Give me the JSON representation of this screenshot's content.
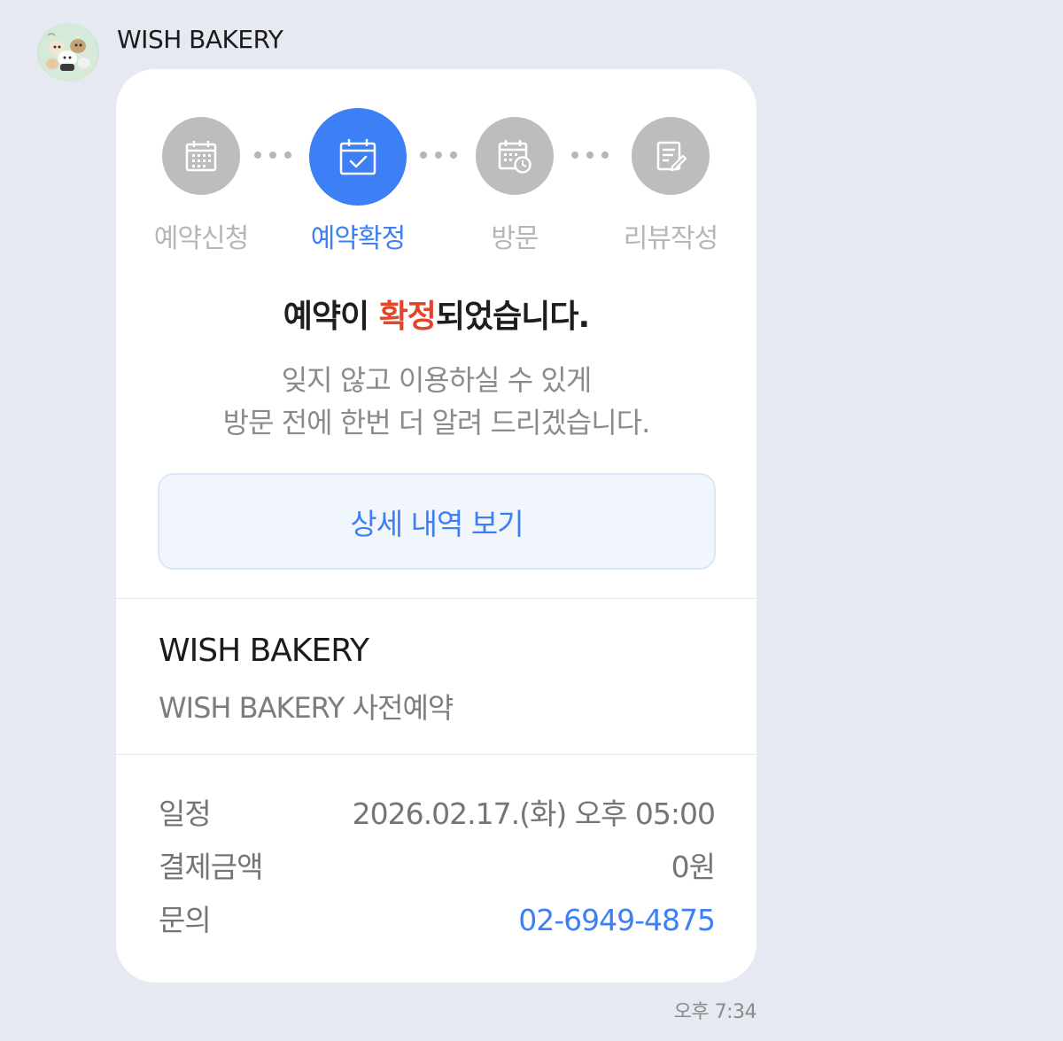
{
  "chat": {
    "sender_name": "WISH BAKERY",
    "timestamp": "오후 7:34"
  },
  "steps": [
    {
      "label": "예약신청",
      "icon": "calendar-icon",
      "active": false
    },
    {
      "label": "예약확정",
      "icon": "calendar-check-icon",
      "active": true
    },
    {
      "label": "방문",
      "icon": "calendar-clock-icon",
      "active": false
    },
    {
      "label": "리뷰작성",
      "icon": "review-edit-icon",
      "active": false
    }
  ],
  "message": {
    "headline_before": "예약이 ",
    "headline_highlight": "확정",
    "headline_after": "되었습니다.",
    "sub_line1": "잊지 않고 이용하실 수 있게",
    "sub_line2": "방문 전에 한번 더 알려 드리겠습니다.",
    "detail_button": "상세 내역 보기"
  },
  "store": {
    "name": "WISH BAKERY",
    "subtitle": "WISH BAKERY 사전예약"
  },
  "info": {
    "schedule_label": "일정",
    "schedule_value": "2026.02.17.(화) 오후 05:00",
    "amount_label": "결제금액",
    "amount_value": "0원",
    "contact_label": "문의",
    "contact_value": "02-6949-4875"
  },
  "colors": {
    "accent": "#3d7ff5",
    "highlight": "#e2452a",
    "inactive_step": "#bdbdbd",
    "background": "#e6e9f1"
  }
}
